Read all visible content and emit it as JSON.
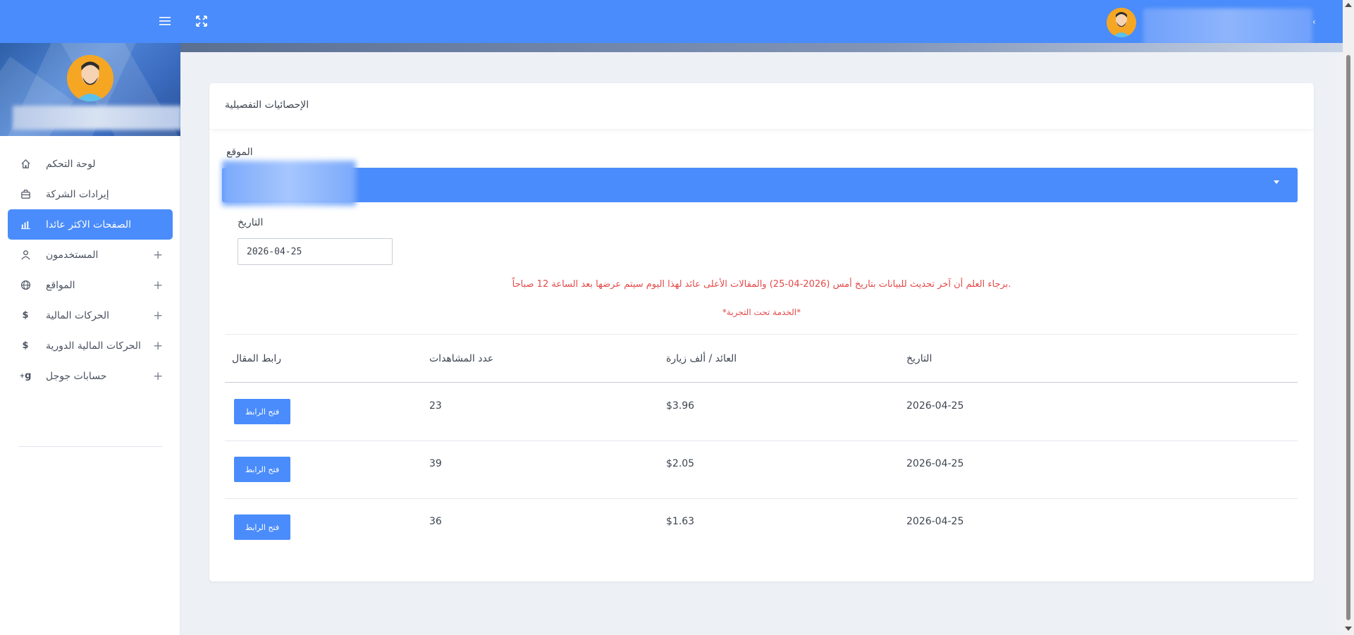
{
  "topbar": {
    "menu_icon": "hamburger-icon",
    "fullscreen_icon": "expand-icon",
    "user_caret": "‹"
  },
  "sidebar": {
    "items": [
      {
        "label": "لوحة التحكم",
        "icon": "home-icon",
        "active": false,
        "expandable": false
      },
      {
        "label": "إيرادات الشركة",
        "icon": "briefcase-icon",
        "active": false,
        "expandable": false
      },
      {
        "label": "الصفحات الاكثر عائدا",
        "icon": "bar-chart-icon",
        "active": true,
        "expandable": false
      },
      {
        "label": "المستخدمون",
        "icon": "user-icon",
        "active": false,
        "expandable": true
      },
      {
        "label": "المواقع",
        "icon": "globe-icon",
        "active": false,
        "expandable": true
      },
      {
        "label": "الحركات المالية",
        "icon": "dollar-icon",
        "active": false,
        "expandable": true
      },
      {
        "label": "الحركات المالية الدورية",
        "icon": "dollar-icon",
        "active": false,
        "expandable": true
      },
      {
        "label": "حسابات جوجل",
        "icon": "google-plus-icon",
        "active": false,
        "expandable": true
      }
    ],
    "plus": "+"
  },
  "card": {
    "title": "الإحصائيات التفصيلية",
    "site_label": "الموقع",
    "date_label": "التاريخ",
    "date_value": "2026-04-25",
    "notice": ".برجاء العلم أن آخر تحديث للبيانات بتاريخ أمس (2026-04-25) والمقالات الأعلى عائد لهذا اليوم سيتم عرضها بعد الساعة 12 صباحاً",
    "notice_trial": "*الخدمة تحت التجربة*"
  },
  "table": {
    "headers": {
      "date": "التاريخ",
      "revenue": "العائد / ألف زيارة",
      "views": "عدد المشاهدات",
      "link": "رابط المقال"
    },
    "rows": [
      {
        "date": "2026-04-25",
        "revenue": "$3.96",
        "views": "23",
        "button": "فتح الرابط"
      },
      {
        "date": "2026-04-25",
        "revenue": "$2.05",
        "views": "39",
        "button": "فتح الرابط"
      },
      {
        "date": "2026-04-25",
        "revenue": "$1.63",
        "views": "36",
        "button": "فتح الرابط"
      }
    ]
  },
  "colors": {
    "primary": "#4a8cfb",
    "notice": "#e34a4a",
    "avatar": "#f5a623"
  }
}
